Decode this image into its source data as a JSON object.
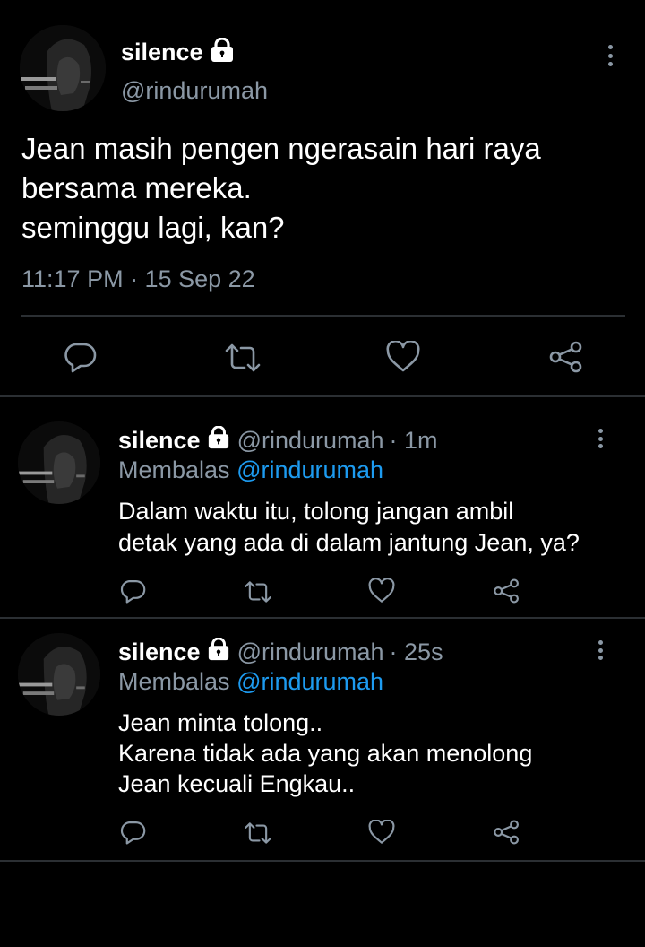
{
  "main_tweet": {
    "display_name": "silence",
    "handle": "@rindurumah",
    "text_lines": [
      "Jean masih pengen ngerasain hari raya",
      "bersama mereka.",
      "seminggu lagi, kan?"
    ],
    "timestamp": "11:17 PM · 15 Sep 22"
  },
  "replies": [
    {
      "display_name": "silence",
      "handle": "@rindurumah",
      "time": "· 1m",
      "replying_prefix": "Membalas",
      "replying_to": "@rindurumah",
      "text_lines": [
        "Dalam waktu itu, tolong jangan ambil",
        "detak yang ada di dalam jantung Jean, ya?"
      ]
    },
    {
      "display_name": "silence",
      "handle": "@rindurumah",
      "time": "· 25s",
      "replying_prefix": "Membalas",
      "replying_to": "@rindurumah",
      "text_lines": [
        "Jean minta tolong..",
        "Karena tidak ada yang akan menolong",
        "Jean kecuali Engkau.."
      ]
    }
  ],
  "icons": [
    "reply-icon",
    "retweet-icon",
    "like-icon",
    "share-icon",
    "lock-icon",
    "more-icon"
  ],
  "colors": {
    "background": "#000000",
    "muted": "#8b98a5",
    "link": "#1d9bf0",
    "divider": "#2b2f33"
  }
}
